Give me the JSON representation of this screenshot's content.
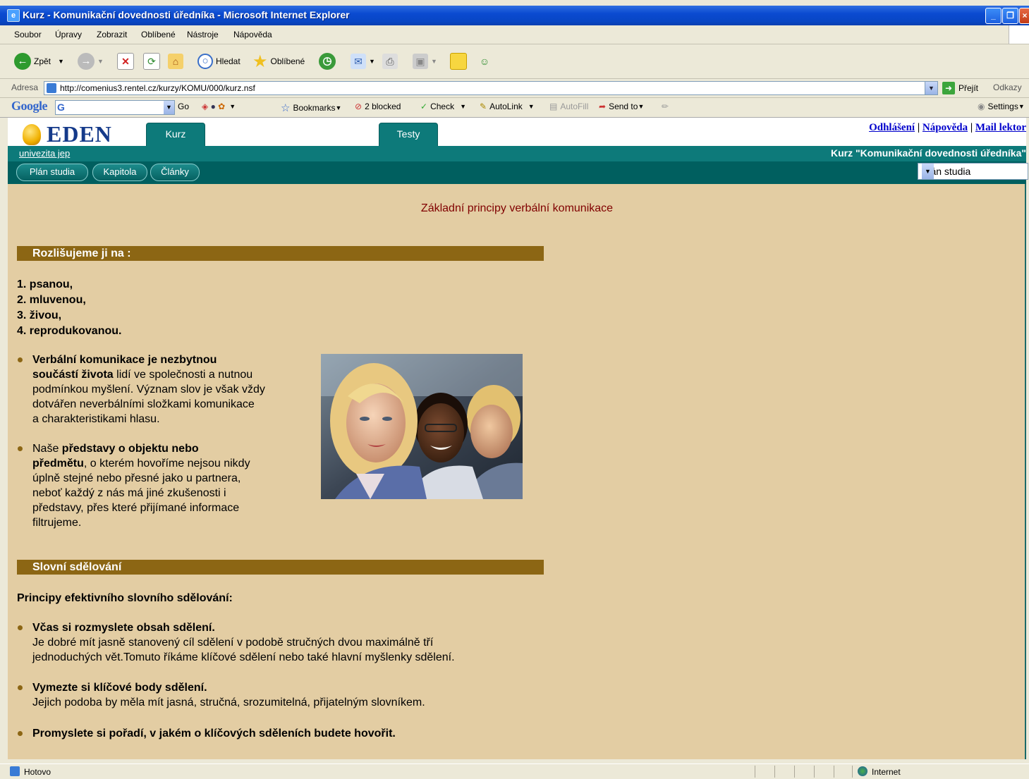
{
  "window": {
    "title": "Kurz - Komunikační dovednosti úředníka - Microsoft Internet Explorer"
  },
  "menu": [
    "Soubor",
    "Úpravy",
    "Zobrazit",
    "Oblíbené",
    "Nástroje",
    "Nápověda"
  ],
  "toolbar": {
    "back": "Zpět",
    "search": "Hledat",
    "favorites": "Oblíbené"
  },
  "address": {
    "label": "Adresa",
    "url": "http://comenius3.rentel.cz/kurzy/KOMU/000/kurz.nsf",
    "go": "Přejít",
    "links": "Odkazy"
  },
  "google": {
    "logo": "Google",
    "go": "Go",
    "bookmarks": "Bookmarks",
    "blocked": "2 blocked",
    "check": "Check",
    "autolink": "AutoLink",
    "autofill": "AutoFill",
    "send_to": "Send to",
    "settings": "Settings"
  },
  "eden": {
    "logo": "EDEN",
    "tabs": [
      "Kurz",
      "Testy"
    ],
    "top_links": [
      "Odhlášení",
      "Nápověda",
      "Mail lektor"
    ],
    "university": "univezita jep",
    "course_title": "Kurz \"Komunikační dovednosti úředníka\"",
    "nav": [
      "Plán studia",
      "Kapitola",
      "Články"
    ],
    "select_value": "Plán studia"
  },
  "content": {
    "title": "Základní principy verbální komunikace",
    "section1": "Rozlišujeme ji na :",
    "numbered": [
      "1. psanou,",
      "2. mluvenou,",
      "3. živou,",
      "4. reprodukovanou."
    ],
    "bullet1_lines": [
      {
        "bold": "Verbální komunikace je nezbytnou",
        "rest": ""
      },
      {
        "bold": "součástí života",
        "rest": " lidí ve společnosti a nutnou"
      },
      {
        "bold": "",
        "rest": "podmínkou myšlení. Význam slov je však vždy"
      },
      {
        "bold": "",
        "rest": "dotvářen neverbálními složkami komunikace"
      },
      {
        "bold": "",
        "rest": "a charakteristikami hlasu."
      }
    ],
    "bullet2_lines": [
      {
        "bold": "představy o objektu nebo",
        "pre": "Naše ",
        "rest": ""
      },
      {
        "bold": "předmětu",
        "pre": "",
        "rest": ", o kterém hovoříme nejsou nikdy"
      },
      {
        "bold": "",
        "pre": "",
        "rest": "úplně stejné nebo přesné jako u partnera,"
      },
      {
        "bold": "",
        "pre": "",
        "rest": "neboť každý z nás má jiné zkušenosti i"
      },
      {
        "bold": "",
        "pre": "",
        "rest": "představy, přes které přijímané informace"
      },
      {
        "bold": "",
        "pre": "",
        "rest": "filtrujeme."
      }
    ],
    "section2": "Slovní sdělování",
    "principles_heading": "Principy efektivního slovního sdělování:",
    "p1_bold": "Včas si rozmyslete obsah sdělení.",
    "p1_line1": "Je dobré mít jasně stanovený cíl sdělení v podobě stručných dvou maximálně tří",
    "p1_line2": "jednoduchých vět.Tomuto říkáme klíčové sdělení nebo také hlavní myšlenky sdělení.",
    "p2_bold": "Vymezte si klíčové body sdělení.",
    "p2_line1": "Jejich podoba by měla mít jasná, stručná, srozumitelná, přijatelným slovníkem.",
    "p3_bold": "Promyslete si pořadí, v jakém o klíčových sděleních budete hovořit."
  },
  "status": {
    "left": "Hotovo",
    "zone": "Internet"
  }
}
